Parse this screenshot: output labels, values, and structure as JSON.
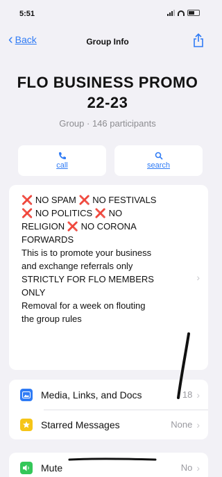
{
  "status": {
    "time": "5:51"
  },
  "nav": {
    "back_label": "Back",
    "title": "Group Info"
  },
  "group": {
    "name_line1": "FLO BUSINESS PROMO",
    "name_line2": "22-23",
    "subtitle": "Group · 146 participants"
  },
  "actions": [
    {
      "label": "call",
      "icon": "phone-icon"
    },
    {
      "label": "search",
      "icon": "search-icon"
    }
  ],
  "description": {
    "line1_a": "NO SPAM",
    "line1_b": "NO FESTIVALS",
    "line2_a": "NO POLITICS",
    "line2_b": "NO",
    "line3_a": "RELIGION",
    "line3_b": "NO CORONA",
    "line4": "FORWARDS",
    "line5": "This is to promote your business",
    "line6": "and exchange referrals only",
    "line7": "STRICTLY FOR FLO MEMBERS",
    "line8": "ONLY",
    "line9": "Removal for a week on flouting",
    "line10": "the group rules",
    "cross_symbol": "❌"
  },
  "rows": {
    "media": {
      "label": "Media, Links, and Docs",
      "value": "18",
      "icon": "photo-icon",
      "color": "#2f7bf5"
    },
    "starred": {
      "label": "Starred Messages",
      "value": "None",
      "icon": "star-icon",
      "color": "#f5c518"
    },
    "mute": {
      "label": "Mute",
      "value": "No",
      "icon": "speaker-icon",
      "color": "#34c759"
    }
  }
}
